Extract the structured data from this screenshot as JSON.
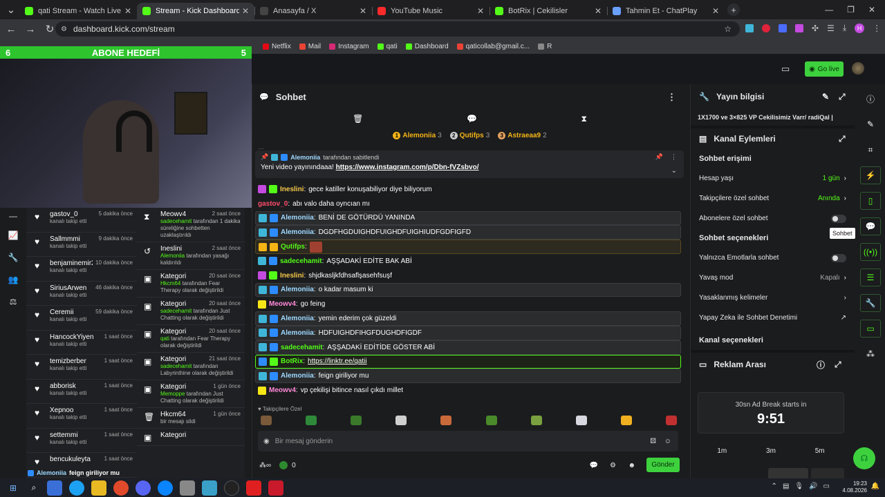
{
  "browser": {
    "tabs": [
      {
        "title": "qati Stream - Watch Live on Kick",
        "color": "#53fc18",
        "active": false
      },
      {
        "title": "Stream - Kick Dashboard",
        "color": "#53fc18",
        "active": true
      },
      {
        "title": "Anasayfa / X",
        "color": "#444",
        "active": false
      },
      {
        "title": "YouTube Music",
        "color": "#ff2a2a",
        "active": false
      },
      {
        "title": "BotRix | Cekilisler",
        "color": "#53fc18",
        "active": false
      },
      {
        "title": "Tahmin Et - ChatPlay",
        "color": "#6aa0ff",
        "active": false
      }
    ],
    "url": "dashboard.kick.com/stream",
    "bookmarks": [
      {
        "label": "Netflix",
        "color": "#e50914"
      },
      {
        "label": "Mail",
        "color": "#ea4335"
      },
      {
        "label": "Instagram",
        "color": "#d62976"
      },
      {
        "label": "qati",
        "color": "#53fc18"
      },
      {
        "label": "Dashboard",
        "color": "#53fc18"
      },
      {
        "label": "qaticollab@gmail.c...",
        "color": "#ea4335"
      },
      {
        "label": "R",
        "color": "#888"
      }
    ],
    "profile_initial": "H"
  },
  "overlay": {
    "left_count": "6",
    "title": "ABONE HEDEFİ",
    "right_count": "5"
  },
  "header": {
    "go_live": "Go live"
  },
  "follows": [
    {
      "name": "gastov_0",
      "time": "5 dakika önce",
      "sub": "kanalı takip etti"
    },
    {
      "name": "Sallmmmi",
      "time": "9 dakika önce",
      "sub": "kanalı takip etti"
    },
    {
      "name": "benjaminemir22",
      "time": "10 dakika önce",
      "sub": "kanalı takip etti"
    },
    {
      "name": "SiriusArwen",
      "time": "46 dakika önce",
      "sub": "kanalı takip etti"
    },
    {
      "name": "Ceremii",
      "time": "59 dakika önce",
      "sub": "kanalı takip etti"
    },
    {
      "name": "HancockYiyen",
      "time": "1 saat önce",
      "sub": "kanalı takip etti"
    },
    {
      "name": "temizberber",
      "time": "1 saat önce",
      "sub": "kanalı takip etti"
    },
    {
      "name": "abborisk",
      "time": "1 saat önce",
      "sub": "kanalı takip etti"
    },
    {
      "name": "Xepnoo",
      "time": "1 saat önce",
      "sub": "kanalı takip etti"
    },
    {
      "name": "settemmi",
      "time": "1 saat önce",
      "sub": "kanalı takip etti"
    },
    {
      "name": "bencukuleyta",
      "time": "1 saat önce",
      "sub": ""
    }
  ],
  "activity": [
    {
      "icon": "hourglass",
      "title": "Meowv4",
      "time": "2 saat önce",
      "a": "sadecehamit",
      "b": " tarafından 1 dakika süreliğine sohbetten uzaklaştırıldı"
    },
    {
      "icon": "undo",
      "title": "Ineslini",
      "time": "2 saat önce",
      "a": "Alemoniia",
      "b": " tarafından yasağı kaldırıldı"
    },
    {
      "icon": "category",
      "title": "Kategori",
      "time": "20 saat önce",
      "a": "Hkcm64",
      "b": " tarafından Fear Therapy olarak değiştirildi"
    },
    {
      "icon": "category",
      "title": "Kategori",
      "time": "20 saat önce",
      "a": "sadecehamit",
      "b": " tarafından Just Chatting olarak değiştirildi"
    },
    {
      "icon": "category",
      "title": "Kategori",
      "time": "20 saat önce",
      "a": "qati",
      "b": " tarafından Fear Therapy olarak değiştirildi"
    },
    {
      "icon": "category",
      "title": "Kategori",
      "time": "21 saat önce",
      "a": "sadecehamit",
      "b": " tarafından Labyrinthine olarak değiştirildi"
    },
    {
      "icon": "category",
      "title": "Kategori",
      "time": "1 gün önce",
      "a": "Memoppe",
      "b": " tarafından Just Chatting olarak değiştirildi"
    },
    {
      "icon": "trash",
      "title": "Hkcm64",
      "time": "1 gün önce",
      "a": "",
      "b": "bir mesajı sildi"
    },
    {
      "icon": "category",
      "title": "Kategori",
      "time": "",
      "a": "",
      "b": ""
    }
  ],
  "overlay_chat": {
    "user": "Alemoniia",
    "text": "feign giriliyor mu"
  },
  "chat": {
    "title": "Sohbet",
    "leaders": [
      {
        "rank": "1",
        "name": "Alemoniia",
        "count": "3"
      },
      {
        "rank": "2",
        "name": "Qutifps",
        "count": "3"
      },
      {
        "rank": "3",
        "name": "Astraeaa9",
        "count": "2"
      }
    ],
    "pinned_by": "Alemoniia",
    "pinned_suffix": "tarafından sabitlendi",
    "pinned_text": "Yeni video yayınındaaa!",
    "pinned_link": "https://www.instagram.com/p/Dbn-fVZsbvo/",
    "messages": [
      {
        "style": "",
        "badges": [
          "#c44ae0",
          "#53fc18"
        ],
        "user": "Ineslini",
        "ucolor": "#f5c84b",
        "text": "gece katiller konuşabiliyor diye biliyorum",
        "link": false
      },
      {
        "style": "",
        "badges": [],
        "user": "gastov_0",
        "ucolor": "#ff4d6a",
        "text": "abı valo daha oyncıan mı",
        "link": false
      },
      {
        "style": "hl",
        "badges": [
          "#3fb6d8",
          "#2d8cff"
        ],
        "user": "Alemoniia",
        "ucolor": "#9ed9ff",
        "text": "BENİ DE GÖTÜRDÜ YANINDA",
        "link": false
      },
      {
        "style": "hl",
        "badges": [
          "#3fb6d8",
          "#2d8cff"
        ],
        "user": "Alemoniia",
        "ucolor": "#9ed9ff",
        "text": "DGDFHGDUIGHDFUIGHDFUIGHIUDFGDFIGFD",
        "link": false
      },
      {
        "style": "hl2",
        "badges": [
          "#f5b516",
          "#f5b516"
        ],
        "user": "Qutifps",
        "ucolor": "#53fc18",
        "text": "",
        "link": false
      },
      {
        "style": "",
        "badges": [
          "#3fb6d8",
          "#2d8cff"
        ],
        "user": "sadecehamit",
        "ucolor": "#53fc18",
        "text": "AŞŞADAKİ EDİTE BAK ABİ",
        "link": false
      },
      {
        "style": "",
        "badges": [
          "#c44ae0",
          "#53fc18"
        ],
        "user": "Ineslini",
        "ucolor": "#f5c84b",
        "text": "shjdkasljkfdhsaflşasehfsuşf",
        "link": false
      },
      {
        "style": "hl",
        "badges": [
          "#3fb6d8",
          "#2d8cff"
        ],
        "user": "Alemoniia",
        "ucolor": "#9ed9ff",
        "text": "o kadar masum ki",
        "link": false
      },
      {
        "style": "",
        "badges": [
          "#f5e616"
        ],
        "user": "Meowv4",
        "ucolor": "#ff8ad8",
        "text": "go feing",
        "link": false
      },
      {
        "style": "hl",
        "badges": [
          "#3fb6d8",
          "#2d8cff"
        ],
        "user": "Alemoniia",
        "ucolor": "#9ed9ff",
        "text": "yemin ederim çok güzeldi",
        "link": false
      },
      {
        "style": "hl",
        "badges": [
          "#3fb6d8",
          "#2d8cff"
        ],
        "user": "Alemoniia",
        "ucolor": "#9ed9ff",
        "text": "HDFUIGHDFIHGFDUGHDFIGDF",
        "link": false
      },
      {
        "style": "hl",
        "badges": [
          "#3fb6d8",
          "#2d8cff"
        ],
        "user": "sadecehamit",
        "ucolor": "#53fc18",
        "text": "AŞŞADAKİ EDİTİDE GÖSTER ABİ",
        "link": false
      },
      {
        "style": "bot",
        "badges": [
          "#2d8cff",
          "#53fc18"
        ],
        "user": "BotRix",
        "ucolor": "#53fc18",
        "text": "https://linktr.ee/qatii",
        "link": true
      },
      {
        "style": "hl",
        "badges": [
          "#3fb6d8",
          "#2d8cff"
        ],
        "user": "Alemoniia",
        "ucolor": "#9ed9ff",
        "text": "feign giriliyor mu",
        "link": false
      },
      {
        "style": "",
        "badges": [
          "#f5e616"
        ],
        "user": "Meowv4",
        "ucolor": "#ff8ad8",
        "text": "vp çekilişi bitince nasıl çıkdı millet",
        "link": false
      }
    ],
    "followers_label": "Takipçilere Özel",
    "emote_colors": [
      "#7a5a3a",
      "#2e8a3a",
      "#3a7a2a",
      "#cfcfcf",
      "#c96a3a",
      "#4a8a2a",
      "#7aa040",
      "#d8d8e0",
      "#f0b020",
      "#c03030"
    ],
    "input_placeholder": "Bir mesaj gönderin",
    "points": "0",
    "send": "Gönder"
  },
  "right": {
    "stream_info_title": "Yayın bilgisi",
    "stream_title": "1X1700 ve 3×825 VP Cekilisimiz Varr/ radiQal |",
    "actions_title": "Kanal Eylemleri",
    "chat_access": "Sohbet erişimi",
    "account_age": {
      "label": "Hesap yaşı",
      "value": "1 gün"
    },
    "followers_only": {
      "label": "Takipçilere özel sohbet",
      "value": "Anında"
    },
    "subs_only": {
      "label": "Abonelere özel sohbet"
    },
    "chat_options": "Sohbet seçenekleri",
    "emotes_only": {
      "label": "Yalnızca Emotlarla sohbet"
    },
    "slow_mode": {
      "label": "Yavaş mod",
      "value": "Kapalı"
    },
    "banned_words": {
      "label": "Yasaklanmış kelimeler"
    },
    "ai_moderation": {
      "label": "Yapay Zeka ile Sohbet Denetimi"
    },
    "channel_options": "Kanal seçenekleri",
    "ad_title": "Reklam Arası",
    "ad_label": "30sn Ad Break starts in",
    "ad_time": "9:51",
    "ad_buttons": [
      "1m",
      "3m",
      "5m"
    ]
  },
  "tooltip": "Sohbet",
  "taskbar": {
    "time": "19:23",
    "date": "4.08.2026"
  }
}
